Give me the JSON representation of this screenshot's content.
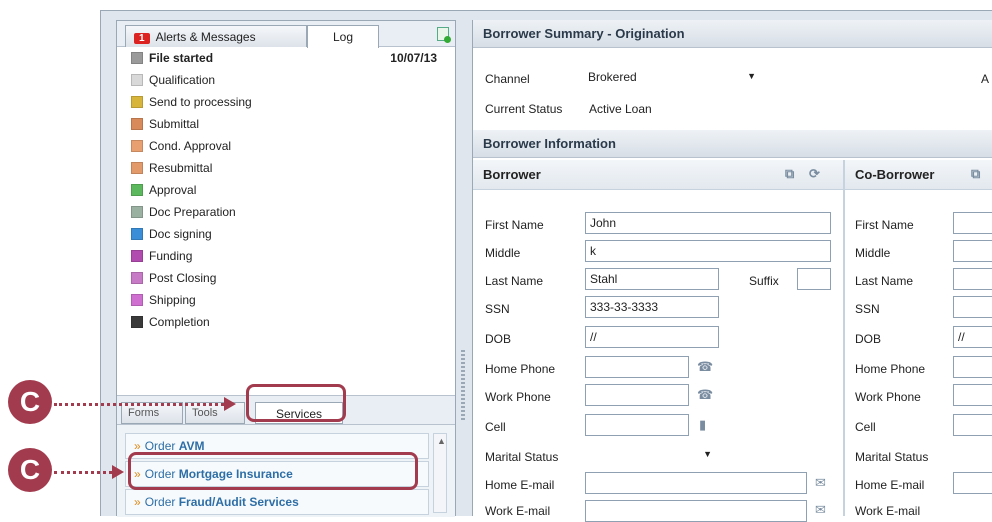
{
  "log_panel": {
    "alerts_badge": "1",
    "alerts_tab": "Alerts & Messages",
    "log_tab": "Log",
    "entries": [
      {
        "label": "File started",
        "date": "10/07/13",
        "color": "#9a9a9a"
      },
      {
        "label": "Qualification",
        "date": "",
        "color": "#d9d9d9"
      },
      {
        "label": "Send to processing",
        "date": "",
        "color": "#d7b53a"
      },
      {
        "label": "Submittal",
        "date": "",
        "color": "#d98a5a"
      },
      {
        "label": "Cond. Approval",
        "date": "",
        "color": "#e8a070"
      },
      {
        "label": "Resubmittal",
        "date": "",
        "color": "#e39a6a"
      },
      {
        "label": "Approval",
        "date": "",
        "color": "#5cb85c"
      },
      {
        "label": "Doc Preparation",
        "date": "",
        "color": "#9ab0a0"
      },
      {
        "label": "Doc signing",
        "date": "",
        "color": "#3a8ed8"
      },
      {
        "label": "Funding",
        "date": "",
        "color": "#b24bb0"
      },
      {
        "label": "Post Closing",
        "date": "",
        "color": "#c77ac6"
      },
      {
        "label": "Shipping",
        "date": "",
        "color": "#cf6fcf"
      },
      {
        "label": "Completion",
        "date": "",
        "color": "#3a3a3a"
      }
    ]
  },
  "lower_tabs": {
    "forms": "Forms",
    "tools": "Tools",
    "services": "Services"
  },
  "services": [
    {
      "prefix": "Order",
      "name": "AVM"
    },
    {
      "prefix": "Order",
      "name": "Mortgage Insurance"
    },
    {
      "prefix": "Order",
      "name": "Fraud/Audit Services"
    }
  ],
  "summary": {
    "title": "Borrower Summary - Origination",
    "channel_label": "Channel",
    "channel_value": "Brokered",
    "right_clipped": "A",
    "status_label": "Current Status",
    "status_value": "Active Loan"
  },
  "borrower_info": {
    "title": "Borrower Information",
    "borrower_head": "Borrower",
    "coborrower_head": "Co-Borrower",
    "labels": {
      "first": "First Name",
      "middle": "Middle",
      "last": "Last Name",
      "suffix": "Suffix",
      "ssn": "SSN",
      "dob": "DOB",
      "home_phone": "Home Phone",
      "work_phone": "Work Phone",
      "cell": "Cell",
      "marital": "Marital Status",
      "home_email": "Home E-mail",
      "work_email": "Work E-mail"
    },
    "borrower": {
      "first": "John",
      "middle": "k",
      "last": "Stahl",
      "ssn": "333-33-3333",
      "dob": "//"
    },
    "coborrower": {
      "dob": "//"
    }
  },
  "callouts": {
    "letter": "C"
  },
  "colors": {
    "callout": "#a23b4d",
    "link": "#2e6ea6",
    "arrow": "#e08a1a"
  }
}
